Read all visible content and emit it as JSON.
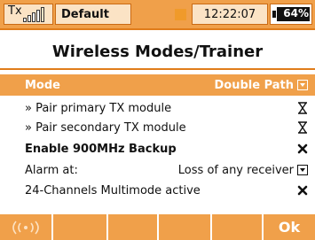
{
  "statusbar": {
    "tx_label": "Tx",
    "model_name": "Default",
    "time": "12:22:07",
    "battery_percent": "64%",
    "signal_level": 4
  },
  "title": "Wireless Modes/Trainer",
  "rows": [
    {
      "label": "Mode",
      "value": "Double Path",
      "control": "dropdown"
    },
    {
      "label": "» Pair primary TX module",
      "value_icon": "hourglass-icon"
    },
    {
      "label": "» Pair secondary TX module",
      "value_icon": "hourglass-icon"
    },
    {
      "label": "Enable 900MHz Backup",
      "value_icon": "cross-icon"
    },
    {
      "label": "Alarm at:",
      "value": "Loss of any receiver",
      "control": "dropdown"
    },
    {
      "label": "24-Channels Multimode active",
      "value_icon": "cross-icon"
    }
  ],
  "bottombar": {
    "wireless_icon": "wireless-icon",
    "ok_label": "Ok"
  },
  "colors": {
    "accent": "#f0a04a",
    "accent_dark": "#e07c1a"
  }
}
